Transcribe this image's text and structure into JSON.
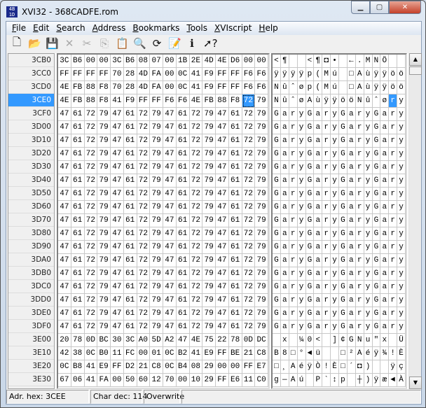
{
  "window": {
    "title": "XVI32 - 368CADFE.rom",
    "icon": "xvi32-app-icon",
    "controls": [
      "minimize",
      "maximize",
      "close"
    ]
  },
  "menu": [
    {
      "label": "File",
      "u": "F",
      "rest": "ile"
    },
    {
      "label": "Edit",
      "u": "E",
      "rest": "dit"
    },
    {
      "label": "Search",
      "u": "S",
      "rest": "earch"
    },
    {
      "label": "Address",
      "u": "A",
      "rest": "ddress"
    },
    {
      "label": "Bookmarks",
      "u": "B",
      "rest": "ookmarks"
    },
    {
      "label": "Tools",
      "u": "T",
      "rest": "ools"
    },
    {
      "label": "XVIscript",
      "u": "X",
      "rest": "VIscript"
    },
    {
      "label": "Help",
      "u": "H",
      "rest": "elp"
    }
  ],
  "toolbar": [
    {
      "icon": "new-file-icon",
      "glyph": "🗋",
      "enabled": true
    },
    {
      "icon": "open-folder-icon",
      "glyph": "📂",
      "enabled": true
    },
    {
      "icon": "save-icon",
      "glyph": "💾",
      "enabled": true
    },
    {
      "icon": "delete-icon",
      "glyph": "✕",
      "enabled": false
    },
    {
      "icon": "cut-icon",
      "glyph": "✂",
      "enabled": false
    },
    {
      "icon": "copy-icon",
      "glyph": "⎘",
      "enabled": false
    },
    {
      "icon": "paste-icon",
      "glyph": "📋",
      "enabled": true
    },
    {
      "icon": "find-icon",
      "glyph": "🔍",
      "enabled": true
    },
    {
      "icon": "find-replace-icon",
      "glyph": "⟳",
      "enabled": true
    },
    {
      "icon": "script-icon",
      "glyph": "📝",
      "enabled": true
    },
    {
      "icon": "info-icon",
      "glyph": "ℹ",
      "enabled": true
    },
    {
      "icon": "context-help-icon",
      "glyph": "➚?",
      "enabled": true
    }
  ],
  "selection": {
    "address": "3CE0",
    "column": 14
  },
  "rows": [
    {
      "addr": "3CB0",
      "hex": "3C B6 00 00 3C B6 08 07 00 1B 2E 4D 4E D6 00 00",
      "chars": [
        "<",
        "¶",
        " ",
        " ",
        "<",
        "¶",
        "◘",
        "•",
        " ",
        "←",
        ".",
        "M",
        "N",
        "Ö",
        " ",
        " "
      ]
    },
    {
      "addr": "3CC0",
      "hex": "FF FF FF FF 70 28 4D FA 00 0C 41 F9 FF FF F6 F6",
      "chars": [
        "ÿ",
        "ÿ",
        "ÿ",
        "ÿ",
        "p",
        "(",
        "M",
        "ú",
        " ",
        "□",
        "A",
        "ù",
        "ÿ",
        "ÿ",
        "ö",
        "ö"
      ]
    },
    {
      "addr": "3CD0",
      "hex": "4E FB 88 F8 70 28 4D FA 00 0C 41 F9 FF FF F6 F6",
      "chars": [
        "N",
        "û",
        "ˆ",
        "ø",
        "p",
        "(",
        "M",
        "ú",
        " ",
        "□",
        "A",
        "ù",
        "ÿ",
        "ÿ",
        "ö",
        "ö"
      ]
    },
    {
      "addr": "3CE0",
      "hex": "4E FB 88 F8 41 F9 FF FF F6 F6 4E FB 88 F8 72 79",
      "chars": [
        "N",
        "û",
        "ˆ",
        "ø",
        "A",
        "ù",
        "ÿ",
        "ÿ",
        "ö",
        "ö",
        "N",
        "û",
        "ˆ",
        "ø",
        "r",
        "y"
      ]
    },
    {
      "addr": "3CF0",
      "hex": "47 61 72 79 47 61 72 79 47 61 72 79 47 61 72 79",
      "chars": "GaryGaryGaryGary"
    },
    {
      "addr": "3D00",
      "hex": "47 61 72 79 47 61 72 79 47 61 72 79 47 61 72 79",
      "chars": "GaryGaryGaryGary"
    },
    {
      "addr": "3D10",
      "hex": "47 61 72 79 47 61 72 79 47 61 72 79 47 61 72 79",
      "chars": "GaryGaryGaryGary"
    },
    {
      "addr": "3D20",
      "hex": "47 61 72 79 47 61 72 79 47 61 72 79 47 61 72 79",
      "chars": "GaryGaryGaryGary"
    },
    {
      "addr": "3D30",
      "hex": "47 61 72 79 47 61 72 79 47 61 72 79 47 61 72 79",
      "chars": "GaryGaryGaryGary"
    },
    {
      "addr": "3D40",
      "hex": "47 61 72 79 47 61 72 79 47 61 72 79 47 61 72 79",
      "chars": "GaryGaryGaryGary"
    },
    {
      "addr": "3D50",
      "hex": "47 61 72 79 47 61 72 79 47 61 72 79 47 61 72 79",
      "chars": "GaryGaryGaryGary"
    },
    {
      "addr": "3D60",
      "hex": "47 61 72 79 47 61 72 79 47 61 72 79 47 61 72 79",
      "chars": "GaryGaryGaryGary"
    },
    {
      "addr": "3D70",
      "hex": "47 61 72 79 47 61 72 79 47 61 72 79 47 61 72 79",
      "chars": "GaryGaryGaryGary"
    },
    {
      "addr": "3D80",
      "hex": "47 61 72 79 47 61 72 79 47 61 72 79 47 61 72 79",
      "chars": "GaryGaryGaryGary"
    },
    {
      "addr": "3D90",
      "hex": "47 61 72 79 47 61 72 79 47 61 72 79 47 61 72 79",
      "chars": "GaryGaryGaryGary"
    },
    {
      "addr": "3DA0",
      "hex": "47 61 72 79 47 61 72 79 47 61 72 79 47 61 72 79",
      "chars": "GaryGaryGaryGary"
    },
    {
      "addr": "3DB0",
      "hex": "47 61 72 79 47 61 72 79 47 61 72 79 47 61 72 79",
      "chars": "GaryGaryGaryGary"
    },
    {
      "addr": "3DC0",
      "hex": "47 61 72 79 47 61 72 79 47 61 72 79 47 61 72 79",
      "chars": "GaryGaryGaryGary"
    },
    {
      "addr": "3DD0",
      "hex": "47 61 72 79 47 61 72 79 47 61 72 79 47 61 72 79",
      "chars": "GaryGaryGaryGary"
    },
    {
      "addr": "3DE0",
      "hex": "47 61 72 79 47 61 72 79 47 61 72 79 47 61 72 79",
      "chars": "GaryGaryGaryGary"
    },
    {
      "addr": "3DF0",
      "hex": "47 61 72 79 47 61 72 79 47 61 72 79 47 61 72 79",
      "chars": "GaryGaryGaryGary"
    },
    {
      "addr": "3E00",
      "hex": "20 78 0D BC 30 3C A0 5D A2 47 4E 75 22 78 0D DC",
      "chars": [
        " ",
        "x",
        " ",
        "¼",
        "0",
        "<",
        " ",
        "]",
        "¢",
        "G",
        "N",
        "u",
        "\"",
        "x",
        " ",
        "Ü"
      ]
    },
    {
      "addr": "3E10",
      "hex": "42 38 0C B0 11 FC 00 01 0C B2 41 E9 FF BE 21 C8",
      "chars": [
        "B",
        "8",
        "□",
        "°",
        "◄",
        "ü",
        " ",
        " ",
        "□",
        "²",
        "A",
        "é",
        "ÿ",
        "¾",
        "!",
        "È"
      ]
    },
    {
      "addr": "3E20",
      "hex": "0C B8 41 E9 FF D2 21 C8 0C B4 08 29 00 00 FF E7",
      "chars": [
        "□",
        "¸",
        "A",
        "é",
        "ÿ",
        "Ò",
        "!",
        "È",
        "□",
        "´",
        "◘",
        ")",
        " ",
        " ",
        "ÿ",
        "ç"
      ]
    },
    {
      "addr": "3E30",
      "hex": "67 06 41 FA 00 50 60 12 70 00 10 29 FF E6 11 C0",
      "chars": [
        "g",
        "—",
        "A",
        "ú",
        " ",
        "P",
        "`",
        "↕",
        "p",
        " ",
        "┼",
        ")",
        "ÿ",
        "æ",
        "◄",
        "À"
      ]
    }
  ],
  "status": {
    "address": "Adr. hex: 3CEE",
    "char": "Char dec: 114",
    "mode": "Overwrite"
  },
  "colors": {
    "selection": "#3399ff"
  }
}
